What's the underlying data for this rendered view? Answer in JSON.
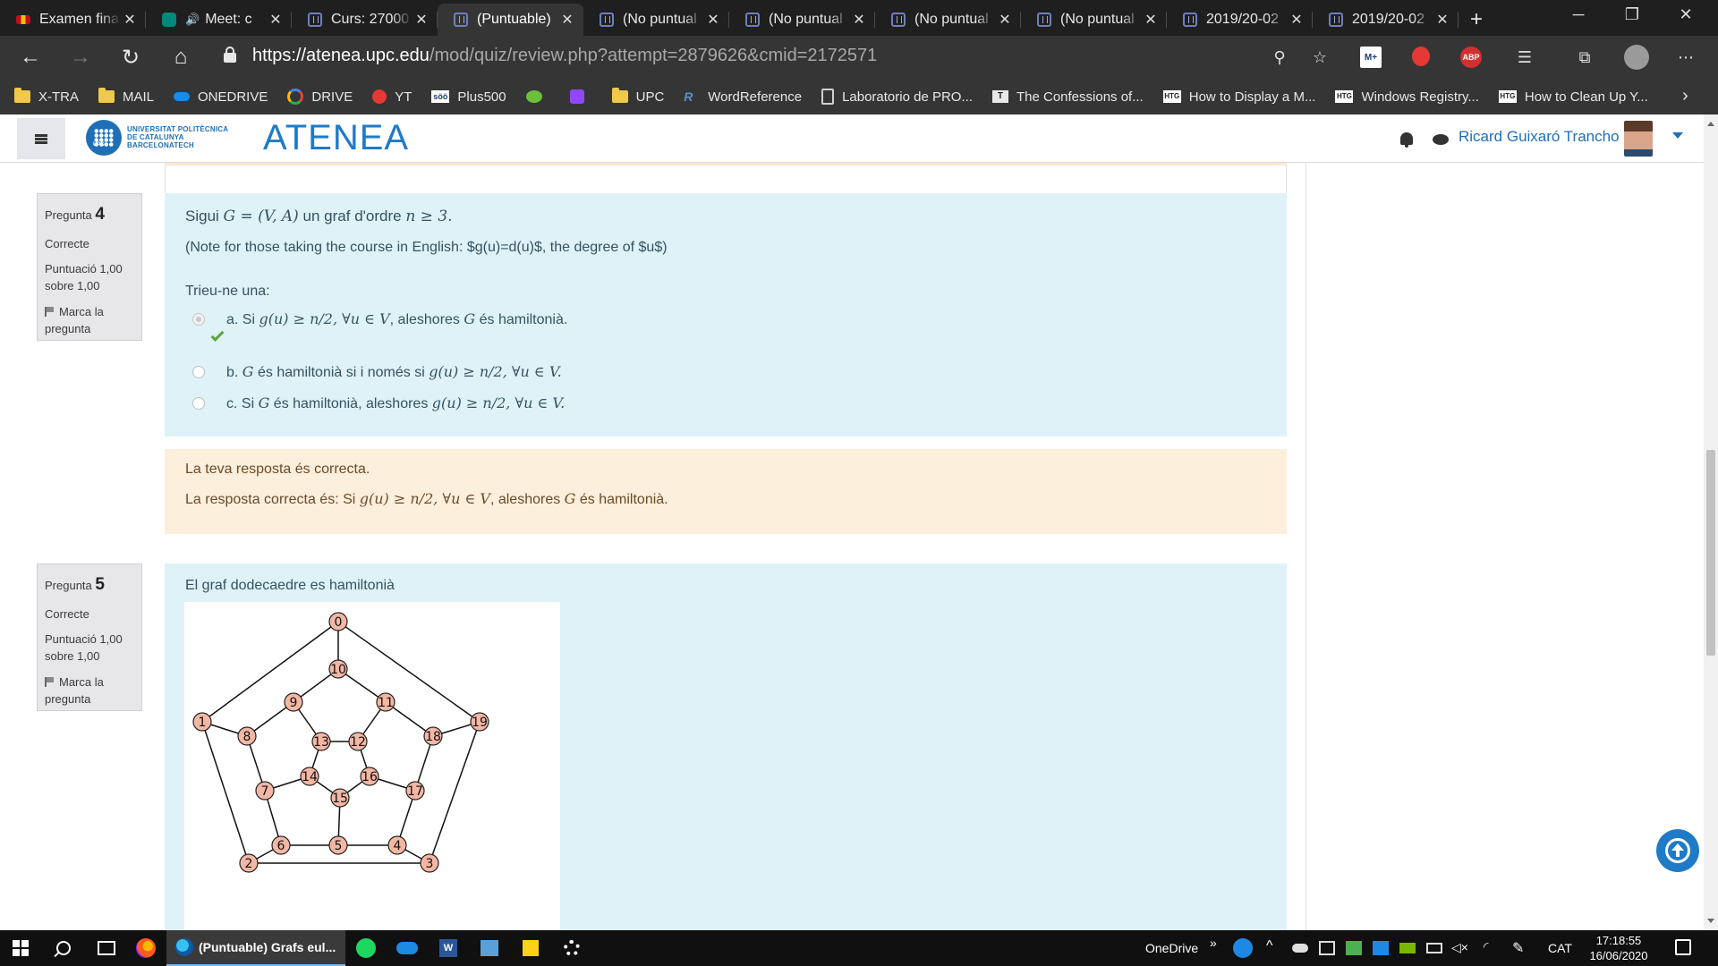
{
  "browser": {
    "tabs": [
      {
        "title": "Examen final",
        "icon": "spain-flag-icon",
        "active": false,
        "fade": true
      },
      {
        "title": "Meet: c",
        "icon": "google-meet-icon",
        "active": false,
        "fade": true,
        "audio": true
      },
      {
        "title": "Curs: 27000",
        "icon": "moodle-icon",
        "active": false,
        "fade": true
      },
      {
        "title": "(Puntuable)",
        "icon": "moodle-icon",
        "active": true,
        "fade": false
      },
      {
        "title": "(No puntual",
        "icon": "moodle-icon",
        "active": false,
        "fade": true
      },
      {
        "title": "(No puntual",
        "icon": "moodle-icon",
        "active": false,
        "fade": true
      },
      {
        "title": "(No puntual",
        "icon": "moodle-icon",
        "active": false,
        "fade": true
      },
      {
        "title": "(No puntual",
        "icon": "moodle-icon",
        "active": false,
        "fade": true
      },
      {
        "title": "2019/20-02",
        "icon": "moodle-icon",
        "active": false,
        "fade": true
      },
      {
        "title": "2019/20-02",
        "icon": "moodle-icon",
        "active": false,
        "fade": true
      }
    ],
    "url_host": "https://atenea.upc.edu",
    "url_path": "/mod/quiz/review.php?attempt=2879626&cmid=2172571",
    "bookmarks": [
      {
        "label": "X-TRA",
        "icon": "folder-icon"
      },
      {
        "label": "MAIL",
        "icon": "folder-icon"
      },
      {
        "label": "ONEDRIVE",
        "icon": "onedrive-icon"
      },
      {
        "label": "DRIVE",
        "icon": "google-icon"
      },
      {
        "label": "YT",
        "icon": "youtube-icon"
      },
      {
        "label": "Plus500",
        "icon": "plus500-icon"
      },
      {
        "label": "",
        "icon": "green-ext-icon"
      },
      {
        "label": "",
        "icon": "twitch-icon"
      },
      {
        "label": "UPC",
        "icon": "folder-icon"
      },
      {
        "label": "WordReference",
        "icon": "wordreference-icon"
      },
      {
        "label": "Laboratorio de PRO...",
        "icon": "document-icon"
      },
      {
        "label": "The Confessions of...",
        "icon": "tb-icon"
      },
      {
        "label": "How to Display a M...",
        "icon": "htg-icon"
      },
      {
        "label": "Windows Registry...",
        "icon": "htg-icon"
      },
      {
        "label": "How to Clean Up Y...",
        "icon": "htg-icon"
      }
    ],
    "ext_abp": "ABP",
    "ext_m": "M+"
  },
  "site": {
    "upc_line1": "UNIVERSITAT POLITÈCNICA",
    "upc_line2": "DE CATALUNYA",
    "upc_line3": "BARCELONATECH",
    "upc_badge": "UPC",
    "app_name": "ATENEA",
    "user_name": "Ricard Guixaró Trancho"
  },
  "q4": {
    "label": "Pregunta",
    "number": "4",
    "state": "Correcte",
    "grade_line1": "Puntuació 1,00",
    "grade_line2": "sobre 1,00",
    "flag_line1": "Marca la",
    "flag_line2": "pregunta",
    "prompt_prefix": "Sigui ",
    "prompt_math1": "G = (V, A)",
    "prompt_mid": " un graf d'ordre ",
    "prompt_math2": "n ≥ 3.",
    "note": "(Note for those taking the course in English: $g(u)=d(u)$, the degree of $u$)",
    "choose": "Trieu-ne una:",
    "options": [
      {
        "prefix": "a. Si ",
        "math1": "g(u) ≥ n/2,  ∀u ∈ V",
        "mid": ", aleshores ",
        "math2": "G",
        "suffix": " és hamiltonià.",
        "selected": true,
        "correct": true
      },
      {
        "prefix": "b. ",
        "math1": "G",
        "mid": " és hamiltonià si i només si ",
        "math2": "g(u) ≥ n/2,  ∀u ∈ V.",
        "suffix": "",
        "selected": false,
        "correct": false
      },
      {
        "prefix": "c. Si  ",
        "math1": "G",
        "mid": " és hamiltonià, aleshores ",
        "math2": "g(u) ≥ n/2,  ∀u ∈ V.",
        "suffix": "",
        "selected": false,
        "correct": false
      }
    ],
    "feedback1": "La teva resposta és correcta.",
    "feedback2_prefix": "La resposta correcta és: Si ",
    "feedback2_math1": "g(u) ≥ n/2,  ∀u ∈ V",
    "feedback2_mid": ", aleshores ",
    "feedback2_math2": "G",
    "feedback2_suffix": " és hamiltonià."
  },
  "q5": {
    "label": "Pregunta",
    "number": "5",
    "state": "Correcte",
    "grade_line1": "Puntuació 1,00",
    "grade_line2": "sobre 1,00",
    "flag_line1": "Marca la",
    "flag_line2": "pregunta",
    "prompt": "El graf dodecaedre es hamiltonià",
    "graph_node_labels": [
      "0",
      "1",
      "2",
      "3",
      "4",
      "5",
      "6",
      "7",
      "8",
      "9",
      "10",
      "11",
      "12",
      "13",
      "14",
      "15",
      "16",
      "17",
      "18",
      "19"
    ],
    "node_color": "#f4b7a4"
  },
  "taskbar": {
    "running_app": "(Puntuable) Grafs eul...",
    "onedrive": "OneDrive",
    "chevron": "»",
    "lang": "CAT",
    "time": "17:18:55",
    "date": "16/06/2020",
    "word_letter": "W"
  }
}
